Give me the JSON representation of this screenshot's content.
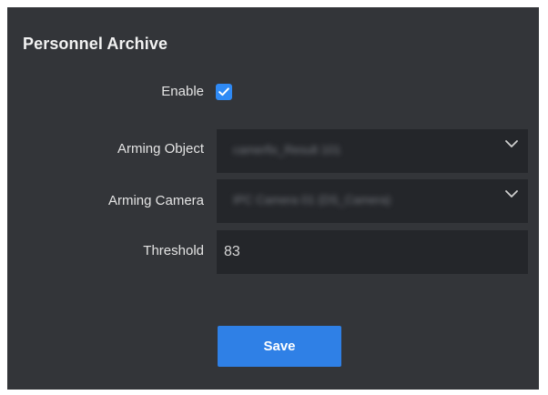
{
  "panel": {
    "title": "Personnel Archive"
  },
  "form": {
    "enable": {
      "label": "Enable",
      "checked": true
    },
    "arming_object": {
      "label": "Arming Object",
      "value": "camerfix_Result 101"
    },
    "arming_camera": {
      "label": "Arming Camera",
      "value": "IPC Camera 01 (DS_Camera)"
    },
    "threshold": {
      "label": "Threshold",
      "value": "83"
    }
  },
  "actions": {
    "save_label": "Save"
  },
  "icons": {
    "checkbox": "checkmark-icon",
    "dropdown": "chevron-down-icon"
  },
  "colors": {
    "panel_bg": "#333539",
    "field_bg": "#24262a",
    "accent": "#2f80e6",
    "text": "#e4e4e4"
  }
}
